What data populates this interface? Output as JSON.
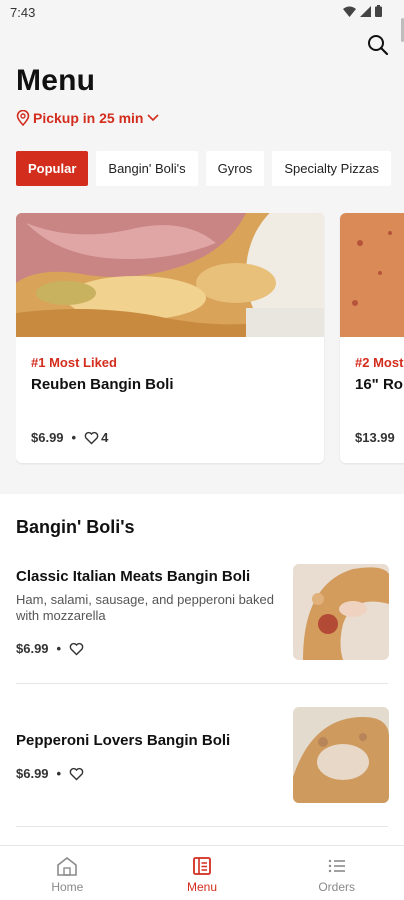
{
  "status": {
    "time": "7:43"
  },
  "header": {
    "title": "Menu",
    "pickup_label": "Pickup in 25 min"
  },
  "categories": [
    "Popular",
    "Bangin' Boli's",
    "Gyros",
    "Specialty Pizzas"
  ],
  "popular": [
    {
      "rank": "#1 Most Liked",
      "name": "Reuben Bangin Boli",
      "price": "$6.99",
      "likes": "4"
    },
    {
      "rank": "#2 Most",
      "name": "16\" Ro",
      "price": "$13.99"
    }
  ],
  "section": {
    "title": "Bangin' Boli's"
  },
  "items": [
    {
      "name": "Classic Italian Meats Bangin Boli",
      "description": "Ham, salami, sausage, and pepperoni baked with mozzarella",
      "price": "$6.99"
    },
    {
      "name": "Pepperoni Lovers Bangin Boli",
      "price": "$6.99"
    }
  ],
  "separator": "•",
  "nav": {
    "home": "Home",
    "menu": "Menu",
    "orders": "Orders"
  },
  "colors": {
    "accent": "#d32d1e",
    "background": "#f5f5f5"
  }
}
